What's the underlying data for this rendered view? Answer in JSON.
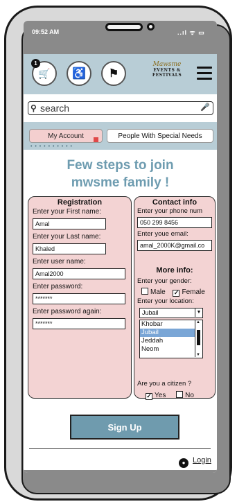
{
  "status_bar": {
    "time": "09:52 AM",
    "icons": "..ıl ᯤ ▭"
  },
  "app_bar": {
    "cart_badge": "1",
    "cart_icon": "🛒",
    "accessibility_icon": "♿",
    "flag_icon": "⚑",
    "logo": {
      "line1": "Mawsme",
      "line2": "EVENTS &",
      "line3": "FESTIVALS"
    }
  },
  "search": {
    "placeholder": "search",
    "icon": "🔍",
    "mic_icon": "🎤"
  },
  "tabs": {
    "my_account": "My Account",
    "special_needs": "People With Special Needs",
    "dots": "• • • • • • • • • •"
  },
  "headline": {
    "line1": "Few steps to join",
    "line2": "mwsme family !"
  },
  "registration": {
    "title": "Registration",
    "first_name_label": "Enter your First name:",
    "first_name_value": "Amal",
    "last_name_label": "Enter your Last name:",
    "last_name_value": "Khaled",
    "username_label": "Enter user name:",
    "username_value": "Amal2000",
    "password_label": "Enter password:",
    "password_value": "*******",
    "password_again_label": "Enter password again:",
    "password_again_value": "*******"
  },
  "contact": {
    "title": "Contact info",
    "phone_label": "Enter your phone num",
    "phone_value": "050 299 8456",
    "email_label": "Enter youe email:",
    "email_value": "amal_2000K@gmail.co",
    "more_info_title": "More info:",
    "gender_label": "Enter your gender:",
    "gender_male": "Male",
    "gender_female": "Female",
    "gender_male_checked": false,
    "gender_female_checked": true,
    "location_label": "Enter your location:",
    "location_selected": "Jubail",
    "location_options": [
      "Khobar",
      "Jubail",
      "Jeddah",
      "Neom"
    ],
    "citizen_question": "Are you a citizen ?",
    "citizen_yes": "Yes",
    "citizen_no": "No",
    "citizen_yes_checked": true,
    "citizen_no_checked": false
  },
  "actions": {
    "sign_up": "Sign Up",
    "login": "Login"
  }
}
